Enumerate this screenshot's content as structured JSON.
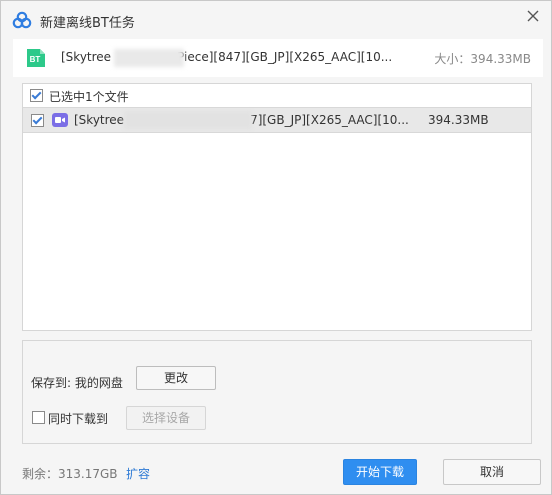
{
  "window": {
    "title": "新建离线BT任务"
  },
  "file": {
    "badge": "BT",
    "name_start": "[Skytree",
    "name_end": "Piece][847][GB_JP][X265_AAC][10...",
    "size_label": "大小：394.33MB"
  },
  "list": {
    "selected_label": "已选中1个文件",
    "items": [
      {
        "name_start": "[Skytree",
        "name_end": "7][GB_JP][X265_AAC][10...",
        "size": "394.33MB",
        "checked": true
      }
    ]
  },
  "save": {
    "path_label": "保存到: 我的网盘",
    "change_button": "更改",
    "sync_label": "同时下载到",
    "device_button": "选择设备"
  },
  "footer": {
    "space_label": "剩余：313.17GB",
    "expand_link": "扩容",
    "start_button": "开始下载",
    "cancel_button": "取消"
  },
  "colors": {
    "accent": "#2f8ef0",
    "bt_badge": "#2dc98a",
    "video_icon": "#7b6ee6"
  }
}
